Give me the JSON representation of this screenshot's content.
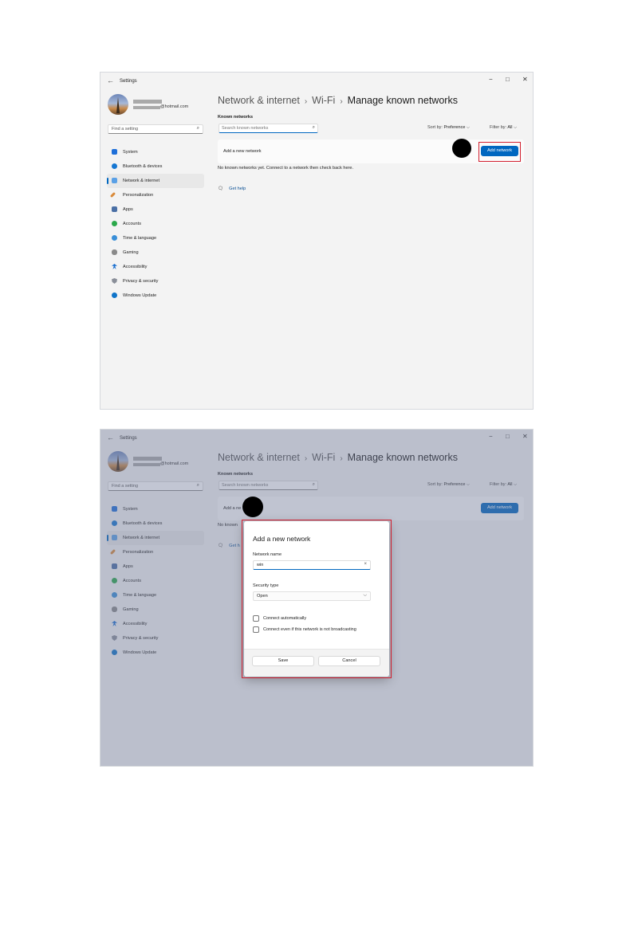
{
  "window": {
    "title": "Settings",
    "back_icon": "←",
    "minimize": "−",
    "maximize": "□",
    "close": "✕"
  },
  "account": {
    "email_suffix": "@hotmail.com"
  },
  "sidebar": {
    "search_placeholder": "Find a setting",
    "search_icon": "⌕",
    "items": [
      {
        "label": "System",
        "color": "#1e6fd9"
      },
      {
        "label": "Bluetooth & devices",
        "color": "#1677d2"
      },
      {
        "label": "Network & internet",
        "color": "#5aa0e6"
      },
      {
        "label": "Personalization",
        "color": "#d98a3a"
      },
      {
        "label": "Apps",
        "color": "#4a6fa5"
      },
      {
        "label": "Accounts",
        "color": "#2aa84a"
      },
      {
        "label": "Time & language",
        "color": "#3a8fd8"
      },
      {
        "label": "Gaming",
        "color": "#8a8a8a"
      },
      {
        "label": "Accessibility",
        "color": "#1a6fd0"
      },
      {
        "label": "Privacy & security",
        "color": "#8a8f99"
      },
      {
        "label": "Windows Update",
        "color": "#0f74c9"
      }
    ]
  },
  "breadcrumb": {
    "part1": "Network & internet",
    "part2": "Wi-Fi",
    "part3": "Manage known networks",
    "sep": "›"
  },
  "main": {
    "known_networks_heading": "Known networks",
    "search_placeholder": "Search known networks",
    "sort_label": "Sort by:",
    "sort_value": "Preference",
    "filter_label": "Filter by:",
    "filter_value": "All",
    "chevron": "⌵",
    "add_new_label": "Add a new network",
    "add_button": "Add network",
    "empty_message": "No known networks yet. Connect to a network then check back here.",
    "get_help": "Get help",
    "help_icon": "🗨"
  },
  "shot2_main": {
    "add_new_label": "Add a ne",
    "empty_message": "No known",
    "get_help": "Get h"
  },
  "dialog": {
    "title": "Add a new network",
    "network_name_label": "Network name",
    "network_name_value": "win",
    "clear_icon": "×",
    "security_type_label": "Security type",
    "security_type_value": "Open",
    "connect_auto": "Connect automatically",
    "connect_hidden": "Connect even if this network is not broadcasting",
    "save": "Save",
    "cancel": "Cancel"
  },
  "colors": {
    "accent": "#0067c0",
    "highlight": "#d21f2f"
  }
}
